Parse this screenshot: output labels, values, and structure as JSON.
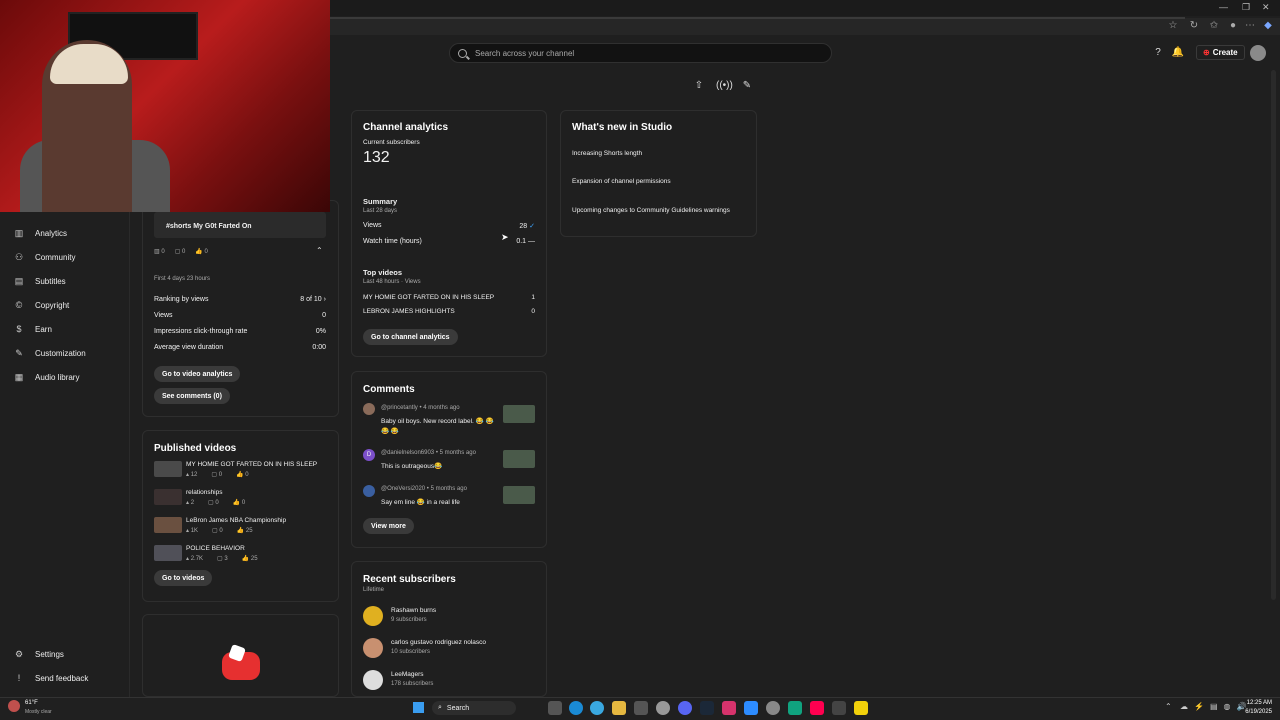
{
  "header": {
    "search_placeholder": "Search across your channel",
    "create_label": "Create"
  },
  "webcam": {
    "video_title": "#shorts My G0t Farted On"
  },
  "sidebar": {
    "items": [
      {
        "label": "Analytics",
        "icon": "analytics-icon"
      },
      {
        "label": "Community",
        "icon": "community-icon"
      },
      {
        "label": "Subtitles",
        "icon": "subtitles-icon"
      },
      {
        "label": "Copyright",
        "icon": "copyright-icon"
      },
      {
        "label": "Earn",
        "icon": "dollar-icon"
      },
      {
        "label": "Customization",
        "icon": "customization-icon"
      },
      {
        "label": "Audio library",
        "icon": "audio-library-icon"
      }
    ],
    "settings": "Settings",
    "feedback": "Send feedback"
  },
  "latest_video": {
    "views": "0",
    "comments": "0",
    "likes": "0",
    "period": "First 4 days 23 hours",
    "ranking_label": "Ranking by views",
    "ranking_value": "8 of 10",
    "stats": [
      {
        "label": "Views",
        "value": "0"
      },
      {
        "label": "Impressions click-through rate",
        "value": "0%"
      },
      {
        "label": "Average view duration",
        "value": "0:00"
      }
    ],
    "analytics_btn": "Go to video analytics",
    "comments_btn": "See comments (0)"
  },
  "published": {
    "title": "Published videos",
    "videos": [
      {
        "title": "MY HOMIE GOT FARTED ON IN HIS SLEEP",
        "views": "12",
        "comments": "0",
        "likes": "0"
      },
      {
        "title": "relationships",
        "views": "2",
        "comments": "0",
        "likes": "0"
      },
      {
        "title": "LeBron James NBA Championship",
        "views": "1K",
        "comments": "0",
        "likes": "25"
      },
      {
        "title": "POLICE BEHAVIOR",
        "views": "2.7K",
        "comments": "3",
        "likes": "25"
      }
    ],
    "btn": "Go to videos"
  },
  "channel_analytics": {
    "title": "Channel analytics",
    "subs_label": "Current subscribers",
    "subs_value": "132",
    "summary_title": "Summary",
    "summary_period": "Last 28 days",
    "views_label": "Views",
    "views_value": "28",
    "watch_label": "Watch time (hours)",
    "watch_value": "0.1",
    "top_title": "Top videos",
    "top_period": "Last 48 hours · Views",
    "top_videos": [
      {
        "title": "MY HOMIE GOT FARTED ON IN HIS SLEEP",
        "value": "1"
      },
      {
        "title": "LEBRON JAMES HIGHLIGHTS",
        "value": "0"
      }
    ],
    "btn": "Go to channel analytics"
  },
  "whats_new": {
    "title": "What's new in Studio",
    "items": [
      "Increasing Shorts length",
      "Expansion of channel permissions",
      "Upcoming changes to Community Guidelines warnings"
    ]
  },
  "comments": {
    "title": "Comments",
    "items": [
      {
        "user": "@princetantly",
        "time": "• 4 months ago",
        "text": "Baby oil boys. New record label. 😂 😂 😂 😂",
        "avatar_color": "#8a6b5a"
      },
      {
        "user": "@danielnelson6903",
        "time": "• 5 months ago",
        "text": "This is outrageous😂",
        "avatar_color": "#7b4fc9"
      },
      {
        "user": "@OneVersi2020",
        "time": "• 5 months ago",
        "text": "Say em line 😂 in a real life",
        "avatar_color": "#3a5fa0"
      }
    ],
    "btn": "View more"
  },
  "recent_subs": {
    "title": "Recent subscribers",
    "period": "Lifetime",
    "items": [
      {
        "name": "Rashawn burns",
        "count": "9 subscribers",
        "color": "#e0b020"
      },
      {
        "name": "carlos gustavo rodriguez nolasco",
        "count": "10 subscribers",
        "color": "#c89070"
      },
      {
        "name": "LeeMagers",
        "count": "178 subscribers",
        "color": "#ddd"
      }
    ]
  },
  "taskbar": {
    "weather_temp": "61°F",
    "weather_desc": "Mostly clear",
    "search_label": "Search",
    "time": "12:25 AM",
    "date": "6/19/2025"
  }
}
